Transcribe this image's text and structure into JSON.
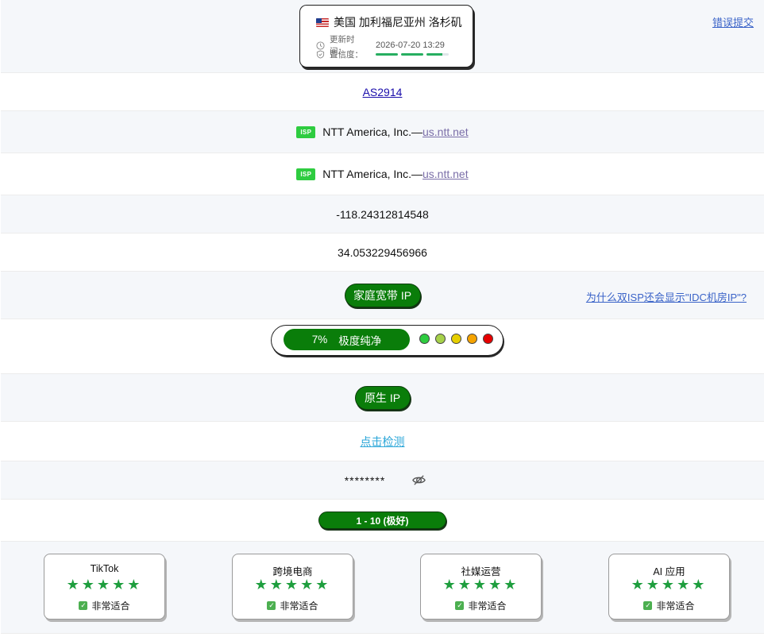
{
  "location": {
    "flag": "us-flag",
    "name": "美国 加利福尼亚州 洛杉矶",
    "update_label": "更新时间：",
    "update_value": "2026-07-20 13:29",
    "trust_label": "置信度：",
    "trust_level": 0.9
  },
  "report_link": "错误提交",
  "asn": "AS2914",
  "isp_rows": [
    {
      "badge": "ISP",
      "name": "NTT America, Inc.—",
      "domain": "us.ntt.net"
    },
    {
      "badge": "ISP",
      "name": "NTT America, Inc.—",
      "domain": "us.ntt.net"
    }
  ],
  "longitude": "-118.24312814548",
  "latitude": "34.053229456966",
  "ip_type": "家庭宽带 IP",
  "why_link": "为什么双ISP还会显示\"IDC机房IP\"?",
  "risk": {
    "percent": "7%",
    "label": "极度纯净",
    "dot_colors": [
      "#2ecc40",
      "#a6d14a",
      "#e6cf00",
      "#f5a300",
      "#e60000"
    ]
  },
  "native_ip": "原生 IP",
  "check_link": "点击检测",
  "masked_value": "********",
  "eye_icon": "eye-slash-icon",
  "score": "1 - 10 (极好)",
  "usecases": [
    {
      "title": "TikTok",
      "stars": "★★★★★",
      "status": "非常适合"
    },
    {
      "title": "跨境电商",
      "stars": "★★★★★",
      "status": "非常适合"
    },
    {
      "title": "社媒运营",
      "stars": "★★★★★",
      "status": "非常适合"
    },
    {
      "title": "AI 应用",
      "stars": "★★★★★",
      "status": "非常适合"
    }
  ],
  "colors": {
    "accent_green": "#0a7d0a",
    "star_green": "#1e9e3e",
    "link_blue": "#3a63c8",
    "isp_badge": "#2ecc40"
  }
}
